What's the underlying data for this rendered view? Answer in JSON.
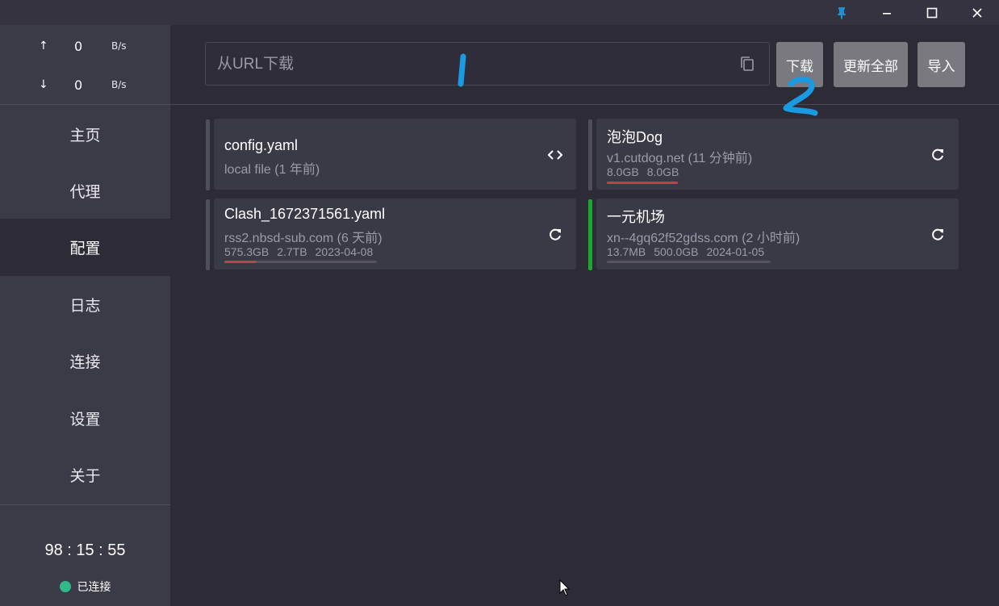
{
  "titlebar": {
    "icons": [
      "pin-icon",
      "minimize-icon",
      "maximize-icon",
      "close-icon"
    ],
    "pin_color": "#1e90d0"
  },
  "sidebar": {
    "upload": {
      "arrow": "↑",
      "value": "0",
      "unit": "B/s"
    },
    "download": {
      "arrow": "↓",
      "value": "0",
      "unit": "B/s"
    },
    "items": [
      {
        "label": "主页"
      },
      {
        "label": "代理"
      },
      {
        "label": "配置"
      },
      {
        "label": "日志"
      },
      {
        "label": "连接"
      },
      {
        "label": "设置"
      },
      {
        "label": "关于"
      }
    ],
    "active_index": 2,
    "clock": "98 : 15 : 55",
    "status": "已连接",
    "status_color": "#33b887"
  },
  "toolbar": {
    "url_placeholder": "从URL下载",
    "download_label": "下载",
    "update_all_label": "更新全部",
    "import_label": "导入"
  },
  "profiles": [
    {
      "title": "config.yaml",
      "subtitle": "local file (1 年前)",
      "icon": "code-icon",
      "active": false
    },
    {
      "title": "泡泡Dog",
      "subtitle": "v1.cutdog.net (11 分钟前)",
      "used": "8.0GB",
      "total": "8.0GB",
      "expire": "",
      "usage_fraction": 1.0,
      "icon": "refresh-icon",
      "active": false
    },
    {
      "title": "Clash_1672371561.yaml",
      "subtitle": "rss2.nbsd-sub.com (6 天前)",
      "used": "575.3GB",
      "total": "2.7TB",
      "expire": "2023-04-08",
      "usage_fraction": 0.21,
      "icon": "refresh-icon",
      "active": false
    },
    {
      "title": "一元机场",
      "subtitle": "xn--4gq62f52gdss.com (2 小时前)",
      "used": "13.7MB",
      "total": "500.0GB",
      "expire": "2024-01-05",
      "usage_fraction": 0.0,
      "icon": "refresh-icon",
      "active": true
    }
  ],
  "annotations": {
    "marks": [
      "1",
      "2"
    ],
    "color": "#1a9ae0"
  },
  "colors": {
    "background": "#2c2b36",
    "sidebar": "#3b3a47",
    "card": "#3a3946",
    "button": "#7a7980",
    "usage_bar": "#b5454e",
    "active_bar": "#1aaa2b"
  }
}
